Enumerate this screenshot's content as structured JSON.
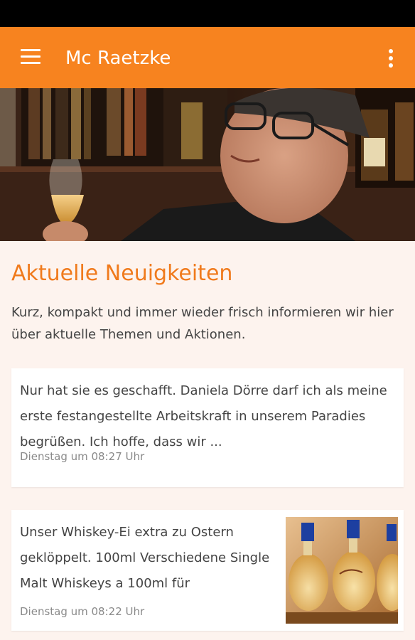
{
  "app_bar": {
    "title": "Mc Raetzke",
    "menu_icon": "hamburger-menu-icon",
    "overflow_icon": "more-vertical-icon",
    "color": "#f7831f"
  },
  "section": {
    "title": "Aktuelle Neuigkeiten",
    "description": "Kurz, kompakt und immer wieder frisch informieren wir hier über aktuelle Themen und Aktionen."
  },
  "news": [
    {
      "text": "Nur hat sie es geschafft. Daniela Dörre darf ich als meine erste festangestellte Arbeitskraft in unserem Paradies begrüßen. Ich hoffe, dass wir ...",
      "time": "Dienstag um 08:27 Uhr"
    },
    {
      "text": "Unser Whiskey-Ei extra zu Ostern geklöppelt. 100ml Verschiedene Single Malt Whiskeys a 100ml für",
      "time": "Dienstag um 08:22 Uhr"
    }
  ],
  "colors": {
    "accent": "#f07a1c",
    "background": "#fdf3ee",
    "card": "#ffffff"
  }
}
